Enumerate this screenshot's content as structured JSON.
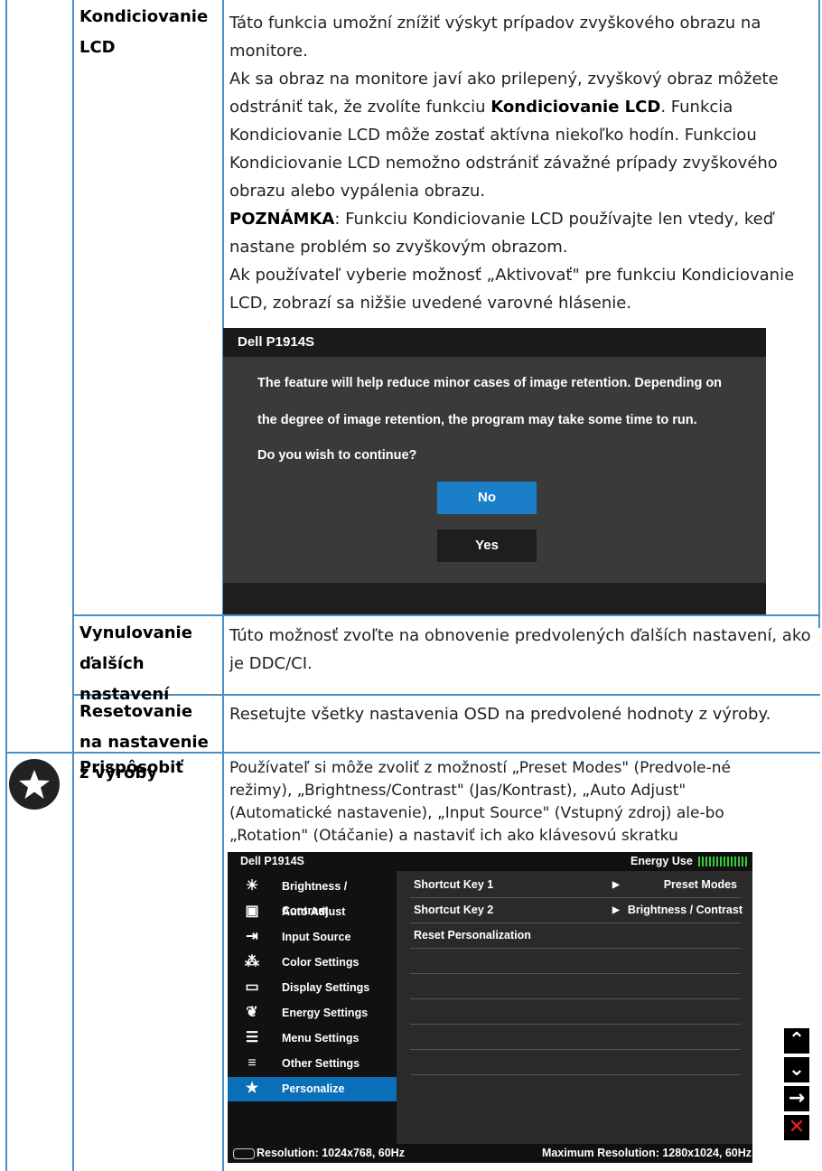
{
  "rows": [
    {
      "name": "Kondiciovanie LCD",
      "para1": "Táto funkcia umožní znížiť výskyt prípadov zvyškového obrazu na monitore.",
      "para2_a": "Ak sa obraz na monitore javí ako prilepený, zvyškový obraz môžete odstrániť tak, že zvolíte funkciu ",
      "para2_b": "Kondiciovanie LCD",
      "para2_c": ". Funkcia Kondiciovanie LCD môže zostať aktívna niekoľko hodín. Funkciou Kondiciovanie LCD nemožno odstrániť závažné prípady zvyškového obrazu alebo vypálenia obrazu.",
      "note_label": "POZNÁMKA",
      "note_text": ": Funkciu Kondiciovanie LCD používajte len vtedy, keď nastane problém so zvyškovým obrazom.",
      "para4": "Ak používateľ vyberie možnosť „Aktivovať\" pre funkciu Kondiciovanie LCD, zobrazí sa nižšie uvedené varovné hlásenie."
    },
    {
      "name": "Vynulovanie ďalších nastavení",
      "desc": "Túto možnosť zvoľte na obnovenie predvolených ďalších nastavení, ako je DDC/CI."
    },
    {
      "name": "Resetovanie na nastavenie z výroby",
      "desc": "Resetujte všetky nastavenia OSD na predvolené hodnoty z výroby."
    },
    {
      "name": "Prispôsobiť",
      "desc": "Používateľ si môže zvoliť z možností „Preset Modes\" (Predvole-né režimy), „Brightness/Contrast\" (Jas/Kontrast), „Auto Adjust\" (Automatické nastavenie), „Input Source\" (Vstupný zdroj) ale-bo „Rotation\" (Otáčanie) a nastaviť ich ako klávesovú skratku"
    }
  ],
  "dialog": {
    "title": "Dell P1914S",
    "line1": "The feature will help reduce minor cases of image retention. Depending on",
    "line2": "the degree of image retention, the program may take some time to run.",
    "line3": "Do you wish to continue?",
    "no": "No",
    "yes": "Yes",
    "accent": "#1a7fc8"
  },
  "osd": {
    "title": "Dell P1914S",
    "energy": "Energy Use",
    "menu": [
      {
        "label": "Brightness / Contrast",
        "icon": "brightness-icon"
      },
      {
        "label": "Auto Adjust",
        "icon": "auto-adjust-icon"
      },
      {
        "label": "Input Source",
        "icon": "input-source-icon"
      },
      {
        "label": "Color Settings",
        "icon": "color-settings-icon"
      },
      {
        "label": "Display Settings",
        "icon": "display-settings-icon"
      },
      {
        "label": "Energy Settings",
        "icon": "energy-settings-icon"
      },
      {
        "label": "Menu Settings",
        "icon": "menu-settings-icon"
      },
      {
        "label": "Other Settings",
        "icon": "other-settings-icon"
      },
      {
        "label": "Personalize",
        "icon": "star-icon"
      }
    ],
    "right": [
      {
        "label": "Shortcut Key 1",
        "value": "Preset Modes"
      },
      {
        "label": "Shortcut Key 2",
        "value": "Brightness / Contrast"
      },
      {
        "label": "Reset Personalization",
        "value": ""
      }
    ],
    "resolution": "Resolution: 1024x768,  60Hz",
    "max_resolution": "Maximum Resolution: 1280x1024,  60Hz",
    "highlight": "#0a6fb8"
  },
  "controls": [
    "up-icon",
    "down-icon",
    "enter-icon",
    "exit-icon"
  ]
}
